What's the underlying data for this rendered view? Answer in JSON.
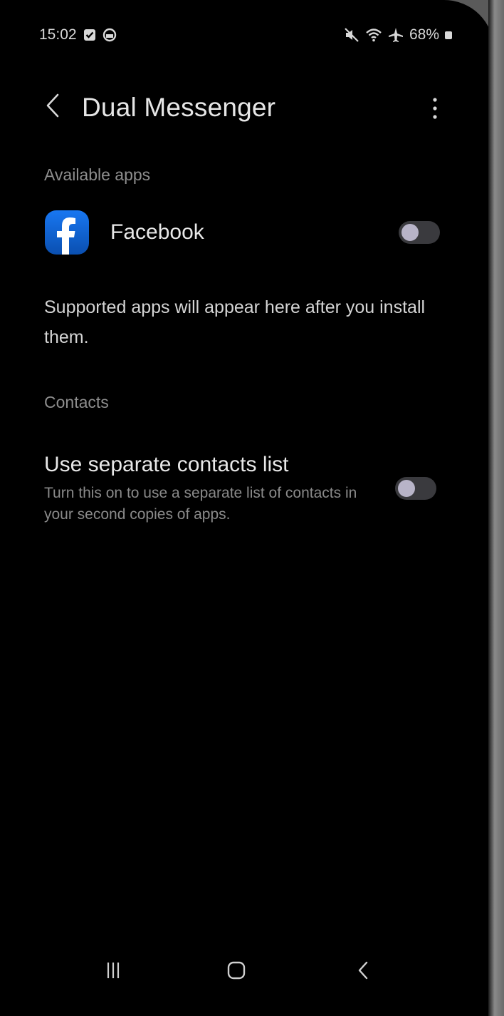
{
  "status_bar": {
    "time": "15:02",
    "battery": "68%",
    "icons_left": [
      "checkbox-notification-icon",
      "circle-notification-icon"
    ],
    "icons_right": [
      "mute-icon",
      "wifi-icon",
      "airplane-icon",
      "battery-icon"
    ]
  },
  "app_bar": {
    "title": "Dual Messenger",
    "back_icon": "chevron-left-icon",
    "more_icon": "more-vertical-icon"
  },
  "available_apps": {
    "header": "Available apps",
    "items": [
      {
        "label": "Facebook",
        "icon": "facebook-icon",
        "enabled": false
      }
    ],
    "info": "Supported apps will appear here after you install them."
  },
  "contacts": {
    "header": "Contacts",
    "title": "Use separate contacts list",
    "subtitle": "Turn this on to use a separate list of contacts in your second copies of apps.",
    "enabled": false
  },
  "nav_bar": {
    "buttons": [
      "recents-icon",
      "home-icon",
      "back-icon"
    ]
  },
  "colors": {
    "background": "#000000",
    "text_primary": "#e8e8e8",
    "text_secondary": "#8e8e8e",
    "toggle_track": "#3a3a3e",
    "toggle_knob": "#b8b4c8",
    "facebook_blue": "#1877f2"
  }
}
